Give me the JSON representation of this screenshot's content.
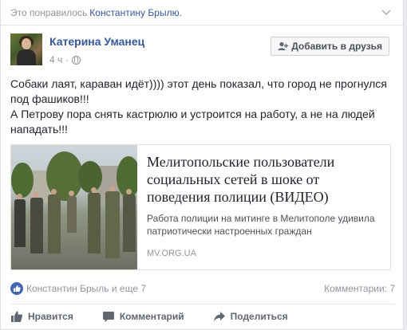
{
  "liked_bar": {
    "prefix": "Это понравилось",
    "user": "Константину Брылю."
  },
  "post": {
    "author": "Катерина Уманец",
    "time": "4 ч ·",
    "add_friend_label": "Добавить в друзья",
    "text_line1": "Собаки лаят, караван идёт)))) этот день показал, что город не прогнулся под фашиков!!!",
    "text_line2": "А Петрову пора снять кастрюлю и устроится на работу, а не на людей нападать!!!"
  },
  "link_preview": {
    "title": "Мелитопольские пользователи социальных сетей в шоке от поведения полиции (ВИДЕО)",
    "description": "Работа полиции на митинге в Мелитополе удивила патриотически настроенных граждан",
    "domain": "MV.ORG.UA"
  },
  "stats": {
    "likes": "Константин Брыль и еще 7",
    "comments": "Комментарии: 7"
  },
  "actions": {
    "like": "Нравится",
    "comment": "Комментарий",
    "share": "Поделиться"
  },
  "colors": {
    "link_blue": "#365899",
    "like_blue": "#4267b2",
    "meta_gray": "#90949c"
  },
  "icons": {
    "chevron": "chevron-down-icon",
    "globe": "globe-icon",
    "add_friend": "add-friend-icon",
    "like": "thumbs-up-icon",
    "comment": "comment-icon",
    "share": "share-arrow-icon"
  }
}
